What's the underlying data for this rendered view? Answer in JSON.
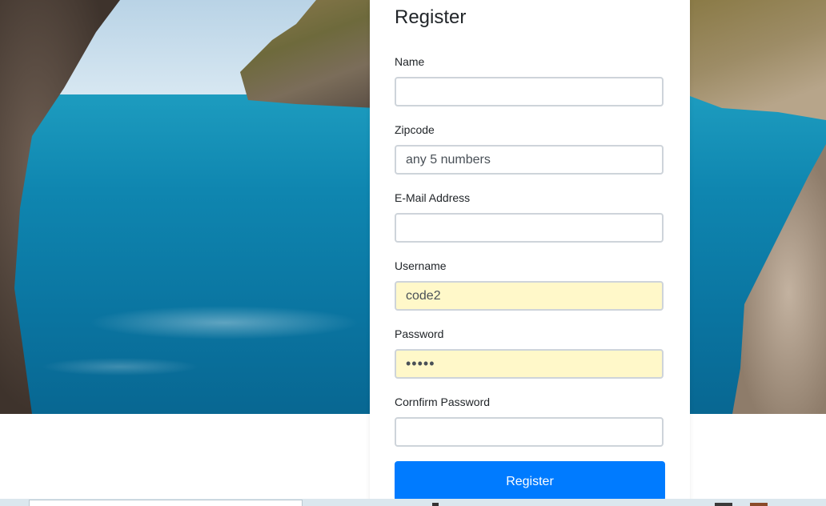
{
  "form": {
    "title": "Register",
    "fields": [
      {
        "label": "Name",
        "value": "",
        "placeholder": ""
      },
      {
        "label": "Zipcode",
        "value": "",
        "placeholder": "any 5 numbers"
      },
      {
        "label": "E-Mail Address",
        "value": "",
        "placeholder": ""
      },
      {
        "label": "Username",
        "value": "code2",
        "placeholder": ""
      },
      {
        "label": "Password",
        "value": "•••••",
        "placeholder": ""
      },
      {
        "label": "Cornfirm Password",
        "value": "",
        "placeholder": ""
      }
    ],
    "submit_label": "Register"
  },
  "colors": {
    "primary": "#007bff",
    "autofill": "#fff8c9",
    "border": "#ced4da"
  }
}
